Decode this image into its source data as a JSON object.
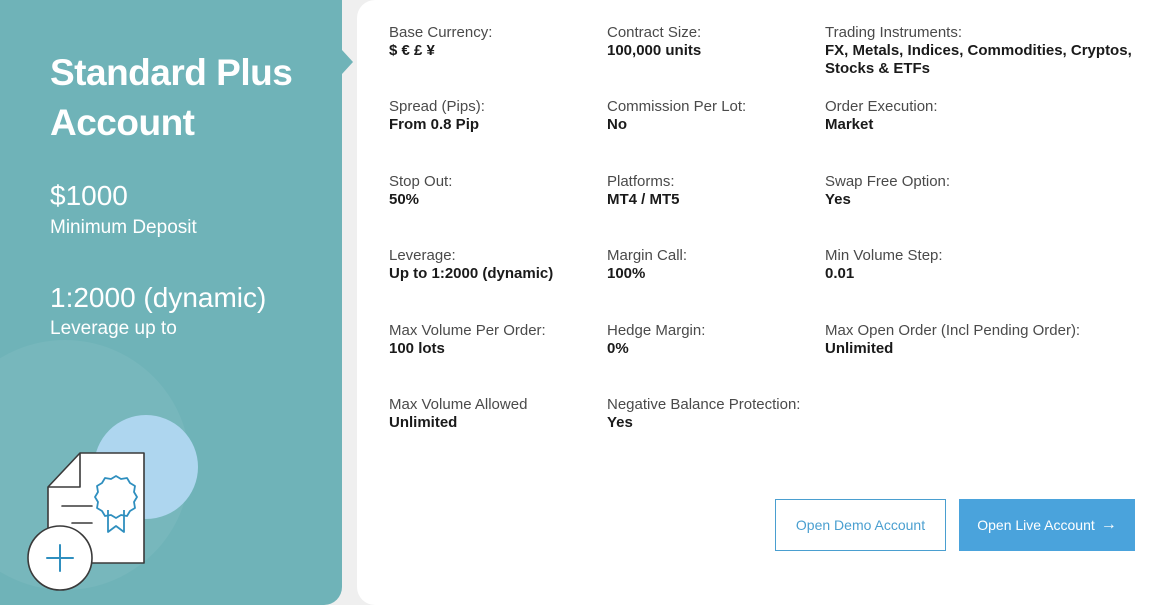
{
  "account": {
    "title": "Standard Plus Account",
    "min_deposit_value": "$1000",
    "min_deposit_label": "Minimum Deposit",
    "leverage_value": "1:2000 (dynamic)",
    "leverage_label": "Leverage up to",
    "illustration_icon": "certificate-plus-icon"
  },
  "specs": [
    {
      "label": "Base Currency:",
      "value": "$ € £ ¥"
    },
    {
      "label": "Contract Size:",
      "value": "100,000 units"
    },
    {
      "label": "Trading Instruments:",
      "value": "FX, Metals, Indices, Commodities, Cryptos, Stocks & ETFs"
    },
    {
      "label": "Spread (Pips):",
      "value": "From 0.8 Pip"
    },
    {
      "label": "Commission Per Lot:",
      "value": "No"
    },
    {
      "label": "Order Execution:",
      "value": "Market"
    },
    {
      "label": "Stop Out:",
      "value": "50%"
    },
    {
      "label": "Platforms:",
      "value": "MT4 / MT5"
    },
    {
      "label": "Swap Free Option:",
      "value": "Yes"
    },
    {
      "label": "Leverage:",
      "value": "Up to 1:2000 (dynamic)"
    },
    {
      "label": "Margin Call:",
      "value": "100%"
    },
    {
      "label": "Min Volume Step:",
      "value": "0.01"
    },
    {
      "label": "Max Volume Per Order:",
      "value": "100 lots"
    },
    {
      "label": "Hedge Margin:",
      "value": "0%"
    },
    {
      "label": "Max Open Order (Incl Pending Order):",
      "value": "Unlimited"
    },
    {
      "label": "Max Volume Allowed",
      "value": "Unlimited"
    },
    {
      "label": "Negative Balance Protection:",
      "value": "Yes"
    }
  ],
  "actions": {
    "demo_label": "Open Demo Account",
    "live_label": "Open Live Account",
    "live_icon": "arrow-right-icon"
  },
  "colors": {
    "teal": "#6fb3b8",
    "blue": "#4aa3dc",
    "light_blue_circle": "#aed6ef"
  }
}
